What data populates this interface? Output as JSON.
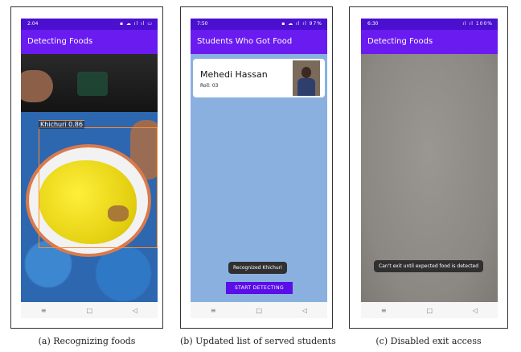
{
  "panels": [
    {
      "status": {
        "time": "2:04",
        "icons": "▪ ☁ ıl ıl ▭"
      },
      "appbar_title": "Detecting Foods",
      "detection_label": "Khichuri 0.86",
      "caption": "(a) Recognizing foods"
    },
    {
      "status": {
        "time": "7:50",
        "icons": "▪ ☁ ıl ıl 97%"
      },
      "appbar_title": "Students Who Got Food",
      "student": {
        "name": "Mehedi Hassan",
        "roll": "Roll: 03"
      },
      "toast": "Recognized Khichuri",
      "button_label": "START DETECTING",
      "caption": "(b) Updated list of served students"
    },
    {
      "status": {
        "time": "6:30",
        "icons": "ıl ıl 100%"
      },
      "appbar_title": "Detecting Foods",
      "toast": "Can't exit until expected food is detected",
      "caption": "(c) Disabled exit access"
    }
  ],
  "nav": {
    "menu": "≡",
    "home": "□",
    "back": "◁"
  },
  "colors": {
    "status_bar": "#4a0fcf",
    "app_bar": "#6a1bf0",
    "accent_button": "#5a0ee8",
    "list_bg": "#8ab0e0",
    "bbox": "#ff8a2a"
  }
}
